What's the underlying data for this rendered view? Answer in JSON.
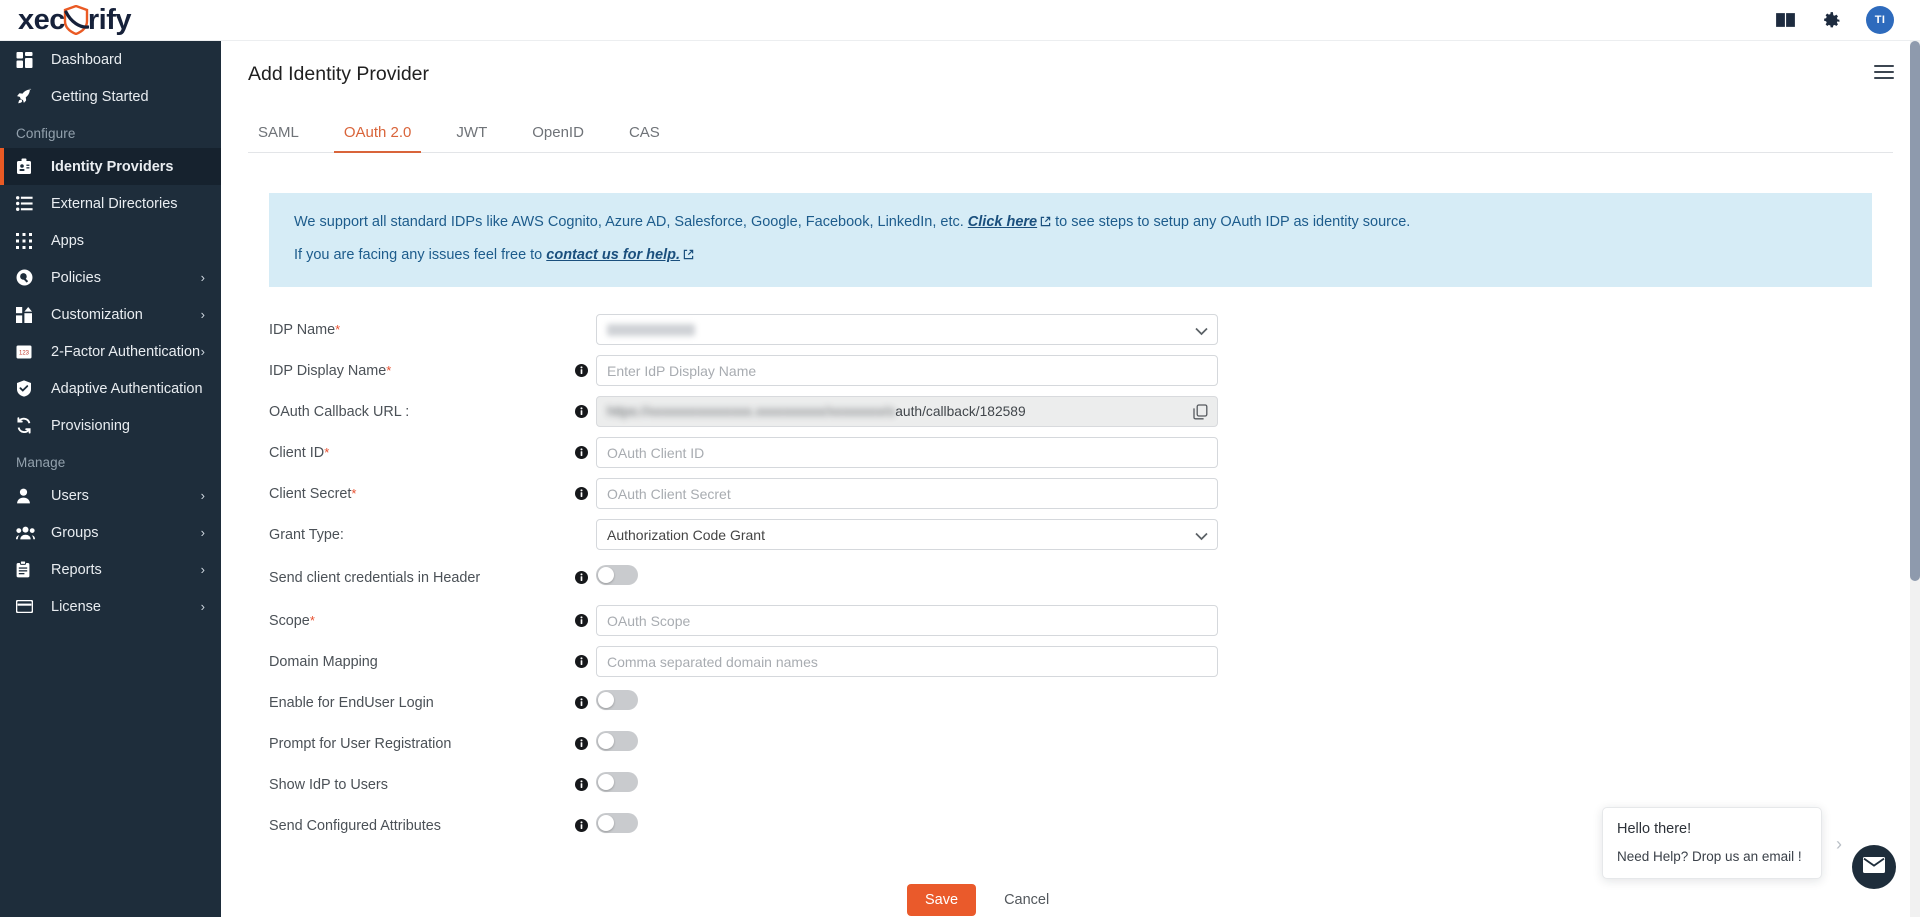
{
  "brand": {
    "logo_prefix": "xec",
    "logo_suffix": "rify",
    "accent_color": "#ea5a24",
    "sidebar_color": "#1e2d3b"
  },
  "topbar": {
    "docs_icon": "book-icon",
    "settings_icon": "gear-icon",
    "avatar_initials": "TI"
  },
  "sidebar": {
    "items": [
      {
        "label": "Dashboard",
        "icon": "dashboard-icon",
        "active": false,
        "chevron": false
      },
      {
        "label": "Getting Started",
        "icon": "rocket-icon",
        "active": false,
        "chevron": false
      }
    ],
    "section_configure": "Configure",
    "configure_items": [
      {
        "label": "Identity Providers",
        "icon": "id-badge-icon",
        "active": true,
        "chevron": false
      },
      {
        "label": "External Directories",
        "icon": "list-icon",
        "active": false,
        "chevron": false
      },
      {
        "label": "Apps",
        "icon": "grid-icon",
        "active": false,
        "chevron": false
      },
      {
        "label": "Policies",
        "icon": "policy-icon",
        "active": false,
        "chevron": true
      },
      {
        "label": "Customization",
        "icon": "customization-icon",
        "active": false,
        "chevron": true
      },
      {
        "label": "2-Factor Authentication",
        "icon": "numpad-icon",
        "active": false,
        "chevron": true
      },
      {
        "label": "Adaptive Authentication",
        "icon": "shield-check-icon",
        "active": false,
        "chevron": false
      },
      {
        "label": "Provisioning",
        "icon": "sync-icon",
        "active": false,
        "chevron": false
      }
    ],
    "section_manage": "Manage",
    "manage_items": [
      {
        "label": "Users",
        "icon": "user-icon",
        "active": false,
        "chevron": true
      },
      {
        "label": "Groups",
        "icon": "users-icon",
        "active": false,
        "chevron": true
      },
      {
        "label": "Reports",
        "icon": "clipboard-icon",
        "active": false,
        "chevron": true
      },
      {
        "label": "License",
        "icon": "card-icon",
        "active": false,
        "chevron": true
      }
    ]
  },
  "page": {
    "title": "Add Identity Provider",
    "menu_icon": "hamburger-icon"
  },
  "tabs": [
    {
      "label": "SAML",
      "active": false
    },
    {
      "label": "OAuth 2.0",
      "active": true
    },
    {
      "label": "JWT",
      "active": false
    },
    {
      "label": "OpenID",
      "active": false
    },
    {
      "label": "CAS",
      "active": false
    }
  ],
  "banner": {
    "line1_before": "We support all standard IDPs like AWS Cognito, Azure AD, Salesforce, Google, Facebook, LinkedIn, etc.",
    "line1_link": "Click here",
    "line1_after": "to see steps to setup any OAuth IDP as identity source.",
    "line2_before": "If you are facing any issues feel free to",
    "line2_link": "contact us for help."
  },
  "form": {
    "idp_name": {
      "label": "IDP Name",
      "required": true,
      "type": "select",
      "value": "",
      "redacted": true,
      "info": false
    },
    "idp_display_name": {
      "label": "IDP Display Name",
      "required": true,
      "type": "text",
      "placeholder": "Enter IdP Display Name",
      "value": "",
      "info": true
    },
    "callback_url": {
      "label": "OAuth Callback URL :",
      "required": false,
      "type": "readonly",
      "value_visible": "auth/callback/182589",
      "value_hidden": "https://xxxxxxxxxxxxxxx.xxxxxxxxxx/xxxxxxxx/o",
      "copy_icon": "copy-icon",
      "info": true
    },
    "client_id": {
      "label": "Client ID",
      "required": true,
      "type": "text",
      "placeholder": "OAuth Client ID",
      "value": "",
      "info": true
    },
    "client_secret": {
      "label": "Client Secret",
      "required": true,
      "type": "text",
      "placeholder": "OAuth Client Secret",
      "value": "",
      "info": true
    },
    "grant_type": {
      "label": "Grant Type:",
      "required": false,
      "type": "select",
      "value": "Authorization Code Grant",
      "info": false
    },
    "send_client_credentials": {
      "label": "Send client credentials in Header",
      "type": "toggle",
      "value": false,
      "info": true
    },
    "scope": {
      "label": "Scope",
      "required": true,
      "type": "text",
      "placeholder": "OAuth Scope",
      "value": "",
      "info": true
    },
    "domain_mapping": {
      "label": "Domain Mapping",
      "required": false,
      "type": "text",
      "placeholder": "Comma separated domain names",
      "value": "",
      "info": true
    },
    "enable_enduser_login": {
      "label": "Enable for EndUser Login",
      "type": "toggle",
      "value": false,
      "info": true
    },
    "prompt_user_registration": {
      "label": "Prompt for User Registration",
      "type": "toggle",
      "value": false,
      "info": true
    },
    "show_idp_to_users": {
      "label": "Show IdP to Users",
      "type": "toggle",
      "value": false,
      "info": true
    },
    "send_configured_attributes": {
      "label": "Send Configured Attributes",
      "type": "toggle",
      "value": false,
      "info": true
    }
  },
  "actions": {
    "save_label": "Save",
    "cancel_label": "Cancel"
  },
  "chat": {
    "greeting": "Hello there!",
    "message": "Need Help? Drop us an email !",
    "fab_icon": "envelope-icon"
  }
}
